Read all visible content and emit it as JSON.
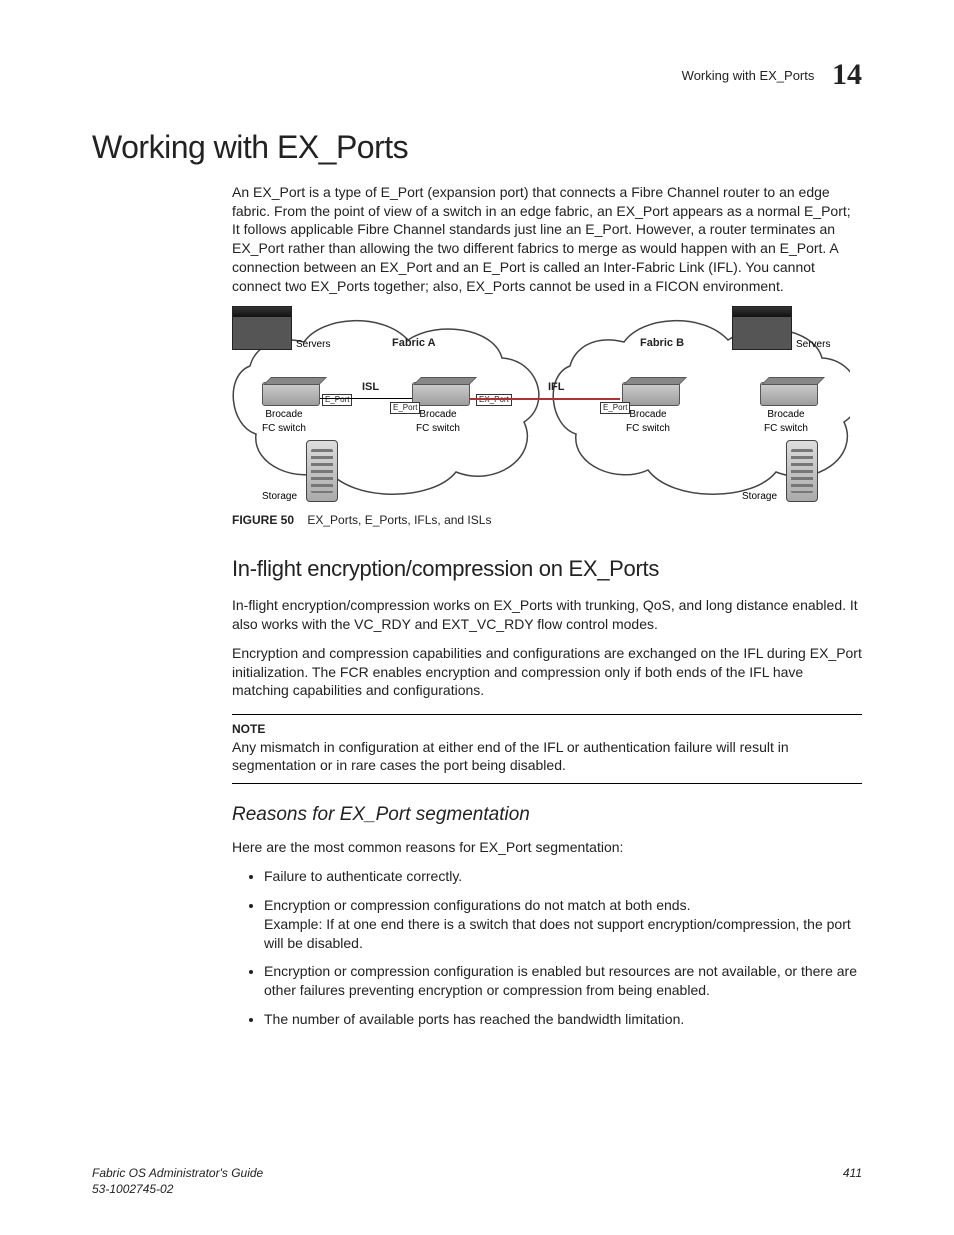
{
  "header": {
    "section": "Working with EX_Ports",
    "chapter": "14"
  },
  "h1": "Working with EX_Ports",
  "intro": "An EX_Port is a type of E_Port (expansion port) that connects a Fibre Channel router to an edge fabric. From the point of view of a switch in an edge fabric, an EX_Port appears as a normal E_Port; It follows applicable Fibre Channel standards just line an E_Port. However, a router terminates an EX_Port rather than allowing the two different fabrics to merge as would happen with an E_Port. A connection between an EX_Port and an E_Port is called an Inter-Fabric Link (IFL). You cannot connect two EX_Ports together; also, EX_Ports cannot be used in a FICON environment.",
  "figure": {
    "labels": {
      "fabricA": "Fabric A",
      "fabricB": "Fabric B",
      "serversL": "Servers",
      "serversR": "Servers",
      "isl": "ISL",
      "ifl": "IFL",
      "eport": "E_Port",
      "export": "EX_Port",
      "brocade": "Brocade\nFC switch",
      "storage": "Storage"
    },
    "caption_num": "FIGURE 50",
    "caption_text": "EX_Ports, E_Ports, IFLs, and ISLs"
  },
  "h2": "In-flight encryption/compression on EX_Ports",
  "p2a": "In-flight encryption/compression works on EX_Ports with trunking, QoS, and long distance enabled. It also works with the VC_RDY and EXT_VC_RDY flow control modes.",
  "p2b": "Encryption and compression capabilities and configurations are exchanged on the IFL during EX_Port initialization. The FCR enables encryption and compression only if both ends of the IFL have matching capabilities and configurations.",
  "note": {
    "title": "NOTE",
    "text": "Any mismatch in configuration at either end of the IFL or authentication failure will result in segmentation or in rare cases the port being disabled."
  },
  "h3": "Reasons for EX_Port segmentation",
  "p3": "Here are the most common reasons for EX_Port segmentation:",
  "bullets": [
    "Failure to authenticate correctly.",
    "Encryption or compression configurations do not match at both ends.\nExample: If at one end there is a switch that does not support encryption/compression, the port will be disabled.",
    "Encryption or compression configuration is enabled but resources are not available, or there are other failures preventing encryption or compression from being enabled.",
    "The number of available ports has reached the bandwidth limitation."
  ],
  "footer": {
    "left1": "Fabric OS Administrator's Guide",
    "left2": "53-1002745-02",
    "right": "411"
  }
}
